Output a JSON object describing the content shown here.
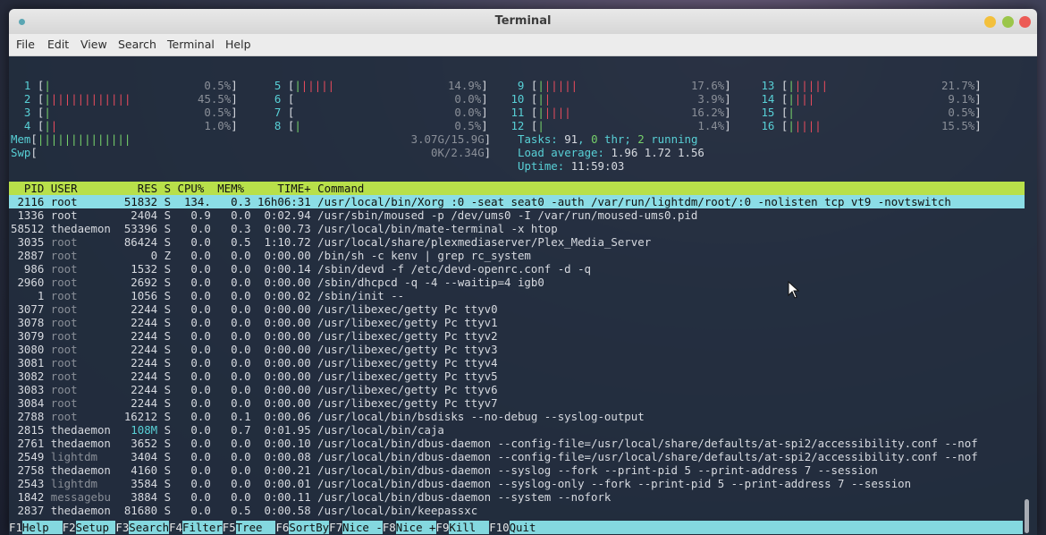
{
  "window": {
    "title": "Terminal"
  },
  "menu": [
    "File",
    "Edit",
    "View",
    "Search",
    "Terminal",
    "Help"
  ],
  "cpus": [
    {
      "num": "1",
      "bar": "|",
      "pct": "0.5%"
    },
    {
      "num": "2",
      "bar": "|||||||||||||",
      "pct": "45.5%"
    },
    {
      "num": "3",
      "bar": "|",
      "pct": "0.5%"
    },
    {
      "num": "4",
      "bar": "||",
      "pct": "1.0%"
    },
    {
      "num": "5",
      "bar": "||||||",
      "pct": "14.9%"
    },
    {
      "num": "6",
      "bar": "",
      "pct": "0.0%"
    },
    {
      "num": "7",
      "bar": "",
      "pct": "0.0%"
    },
    {
      "num": "8",
      "bar": "|",
      "pct": "0.5%"
    },
    {
      "num": "9",
      "bar": "||||||",
      "pct": "17.6%"
    },
    {
      "num": "10",
      "bar": "||",
      "pct": "3.9%"
    },
    {
      "num": "11",
      "bar": "|||||",
      "pct": "16.2%"
    },
    {
      "num": "12",
      "bar": "|",
      "pct": "1.4%"
    },
    {
      "num": "13",
      "bar": "||||||",
      "pct": "21.7%"
    },
    {
      "num": "14",
      "bar": "||||",
      "pct": "9.1%"
    },
    {
      "num": "15",
      "bar": "|",
      "pct": "0.5%"
    },
    {
      "num": "16",
      "bar": "|||||",
      "pct": "15.5%"
    }
  ],
  "mem": {
    "label": "Mem",
    "bar": "||||||||||||||",
    "value": "3.07G/15.9G"
  },
  "swp": {
    "label": "Swp",
    "bar": "",
    "value": "0K/2.34G"
  },
  "tasks": {
    "label": "Tasks: ",
    "count": "91",
    "sep1": ", ",
    "thr": "0",
    "thr_label": " thr; ",
    "running": "2",
    "running_label": " running"
  },
  "load": {
    "label": "Load average: ",
    "v1": "1.96",
    "v2": "1.72",
    "v3": "1.56"
  },
  "uptime": {
    "label": "Uptime: ",
    "value": "11:59:03"
  },
  "columns": [
    "PID",
    "USER",
    "RES",
    "S",
    "CPU%",
    "MEM%",
    "TIME+",
    "Command"
  ],
  "processes": [
    {
      "pid": "2116",
      "user": "root",
      "res": "51832",
      "s": "S",
      "cpu": "134.",
      "mem": "0.3",
      "time": "16h06:31",
      "cmd": "/usr/local/bin/Xorg :0 -seat seat0 -auth /var/run/lightdm/root/:0 -nolisten tcp vt9 -novtswitch",
      "selected": true
    },
    {
      "pid": "1336",
      "user": "root",
      "res": "2404",
      "s": "S",
      "cpu": "0.9",
      "mem": "0.0",
      "time": "0:02.94",
      "cmd": "/usr/sbin/moused -p /dev/ums0 -I /var/run/moused-ums0.pid"
    },
    {
      "pid": "58512",
      "user": "thedaemon",
      "res": "53396",
      "s": "S",
      "cpu": "0.0",
      "mem": "0.3",
      "time": "0:00.73",
      "cmd": "/usr/local/bin/mate-terminal -x htop"
    },
    {
      "pid": "3035",
      "user": "root",
      "res": "86424",
      "s": "S",
      "cpu": "0.0",
      "mem": "0.5",
      "time": "1:10.72",
      "cmd": "/usr/local/share/plexmediaserver/Plex_Media_Server",
      "dim": true
    },
    {
      "pid": "2887",
      "user": "root",
      "res": "0",
      "s": "Z",
      "cpu": "0.0",
      "mem": "0.0",
      "time": "0:00.00",
      "cmd": "/bin/sh -c kenv | grep rc_system",
      "dim": true
    },
    {
      "pid": "986",
      "user": "root",
      "res": "1532",
      "s": "S",
      "cpu": "0.0",
      "mem": "0.0",
      "time": "0:00.14",
      "cmd": "/sbin/devd -f /etc/devd-openrc.conf -d -q",
      "dim": true
    },
    {
      "pid": "2960",
      "user": "root",
      "res": "2692",
      "s": "S",
      "cpu": "0.0",
      "mem": "0.0",
      "time": "0:00.00",
      "cmd": "/sbin/dhcpcd -q -4 --waitip=4 igb0",
      "dim": true
    },
    {
      "pid": "1",
      "user": "root",
      "res": "1056",
      "s": "S",
      "cpu": "0.0",
      "mem": "0.0",
      "time": "0:00.02",
      "cmd": "/sbin/init --",
      "dim": true
    },
    {
      "pid": "3077",
      "user": "root",
      "res": "2244",
      "s": "S",
      "cpu": "0.0",
      "mem": "0.0",
      "time": "0:00.00",
      "cmd": "/usr/libexec/getty Pc ttyv0",
      "dim": true
    },
    {
      "pid": "3078",
      "user": "root",
      "res": "2244",
      "s": "S",
      "cpu": "0.0",
      "mem": "0.0",
      "time": "0:00.00",
      "cmd": "/usr/libexec/getty Pc ttyv1",
      "dim": true
    },
    {
      "pid": "3079",
      "user": "root",
      "res": "2244",
      "s": "S",
      "cpu": "0.0",
      "mem": "0.0",
      "time": "0:00.00",
      "cmd": "/usr/libexec/getty Pc ttyv2",
      "dim": true
    },
    {
      "pid": "3080",
      "user": "root",
      "res": "2244",
      "s": "S",
      "cpu": "0.0",
      "mem": "0.0",
      "time": "0:00.00",
      "cmd": "/usr/libexec/getty Pc ttyv3",
      "dim": true
    },
    {
      "pid": "3081",
      "user": "root",
      "res": "2244",
      "s": "S",
      "cpu": "0.0",
      "mem": "0.0",
      "time": "0:00.00",
      "cmd": "/usr/libexec/getty Pc ttyv4",
      "dim": true
    },
    {
      "pid": "3082",
      "user": "root",
      "res": "2244",
      "s": "S",
      "cpu": "0.0",
      "mem": "0.0",
      "time": "0:00.00",
      "cmd": "/usr/libexec/getty Pc ttyv5",
      "dim": true
    },
    {
      "pid": "3083",
      "user": "root",
      "res": "2244",
      "s": "S",
      "cpu": "0.0",
      "mem": "0.0",
      "time": "0:00.00",
      "cmd": "/usr/libexec/getty Pc ttyv6",
      "dim": true
    },
    {
      "pid": "3084",
      "user": "root",
      "res": "2244",
      "s": "S",
      "cpu": "0.0",
      "mem": "0.0",
      "time": "0:00.00",
      "cmd": "/usr/libexec/getty Pc ttyv7",
      "dim": true
    },
    {
      "pid": "2788",
      "user": "root",
      "res": "16212",
      "s": "S",
      "cpu": "0.0",
      "mem": "0.1",
      "time": "0:00.06",
      "cmd": "/usr/local/bin/bsdisks --no-debug --syslog-output",
      "dim": true
    },
    {
      "pid": "2815",
      "user": "thedaemon",
      "res": "108M",
      "s": "S",
      "cpu": "0.0",
      "mem": "0.7",
      "time": "0:01.95",
      "cmd": "/usr/local/bin/caja",
      "resHi": true
    },
    {
      "pid": "2761",
      "user": "thedaemon",
      "res": "3652",
      "s": "S",
      "cpu": "0.0",
      "mem": "0.0",
      "time": "0:00.10",
      "cmd": "/usr/local/bin/dbus-daemon --config-file=/usr/local/share/defaults/at-spi2/accessibility.conf --nof"
    },
    {
      "pid": "2549",
      "user": "lightdm",
      "res": "3404",
      "s": "S",
      "cpu": "0.0",
      "mem": "0.0",
      "time": "0:00.08",
      "cmd": "/usr/local/bin/dbus-daemon --config-file=/usr/local/share/defaults/at-spi2/accessibility.conf --nof",
      "dim": true
    },
    {
      "pid": "2758",
      "user": "thedaemon",
      "res": "4160",
      "s": "S",
      "cpu": "0.0",
      "mem": "0.0",
      "time": "0:00.21",
      "cmd": "/usr/local/bin/dbus-daemon --syslog --fork --print-pid 5 --print-address 7 --session"
    },
    {
      "pid": "2543",
      "user": "lightdm",
      "res": "3584",
      "s": "S",
      "cpu": "0.0",
      "mem": "0.0",
      "time": "0:00.01",
      "cmd": "/usr/local/bin/dbus-daemon --syslog-only --fork --print-pid 5 --print-address 7 --session",
      "dim": true
    },
    {
      "pid": "1842",
      "user": "messagebu",
      "res": "3884",
      "s": "S",
      "cpu": "0.0",
      "mem": "0.0",
      "time": "0:00.11",
      "cmd": "/usr/local/bin/dbus-daemon --system --nofork",
      "dim": true
    },
    {
      "pid": "2837",
      "user": "thedaemon",
      "res": "81680",
      "s": "S",
      "cpu": "0.0",
      "mem": "0.5",
      "time": "0:00.58",
      "cmd": "/usr/local/bin/keepassxc"
    }
  ],
  "fkeys": [
    {
      "key": "F1",
      "label": "Help  "
    },
    {
      "key": "F2",
      "label": "Setup "
    },
    {
      "key": "F3",
      "label": "Search"
    },
    {
      "key": "F4",
      "label": "Filter"
    },
    {
      "key": "F5",
      "label": "Tree  "
    },
    {
      "key": "F6",
      "label": "SortBy"
    },
    {
      "key": "F7",
      "label": "Nice -"
    },
    {
      "key": "F8",
      "label": "Nice +"
    },
    {
      "key": "F9",
      "label": "Kill  "
    },
    {
      "key": "F10",
      "label": "Quit"
    }
  ],
  "colors": {
    "header_bg": "#b8e04a",
    "selected_bg": "#8bdde6",
    "bar_green": "#76d06a",
    "bar_red": "#e34a5c",
    "label_cyan": "#58d0d6"
  }
}
